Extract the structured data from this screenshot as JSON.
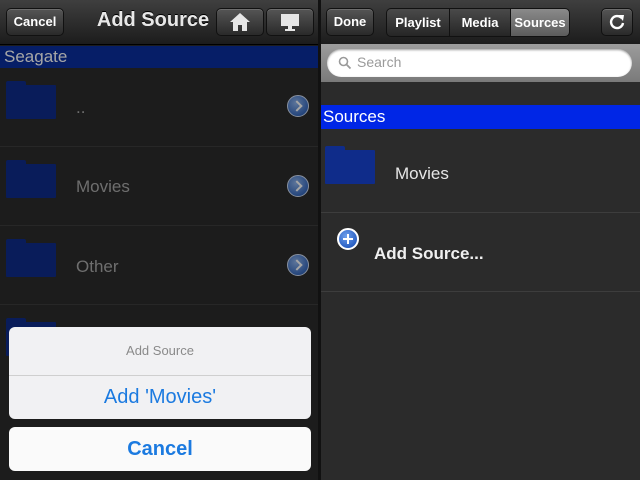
{
  "left_panel": {
    "navbar": {
      "cancel_label": "Cancel",
      "title": "Add Source",
      "home_icon": "home-icon",
      "display_icon": "monitor-icon"
    },
    "section_header": "Seagate",
    "rows": [
      {
        "label": "..",
        "icon": "folder-icon"
      },
      {
        "label": "Movies",
        "icon": "folder-icon"
      },
      {
        "label": "Other",
        "icon": "folder-icon"
      }
    ],
    "action_sheet": {
      "title": "Add Source",
      "action_label": "Add 'Movies'",
      "cancel_label": "Cancel"
    }
  },
  "right_panel": {
    "navbar": {
      "done_label": "Done",
      "segments": [
        "Playlist",
        "Media",
        "Sources"
      ],
      "selected_segment": "Sources",
      "refresh_icon": "refresh-icon"
    },
    "search": {
      "placeholder": "Search"
    },
    "section_header": "Sources",
    "items": [
      {
        "label": "Movies",
        "icon": "folder-icon"
      }
    ],
    "add_source_label": "Add Source..."
  },
  "colors": {
    "section_header_left": "#0a2f9e",
    "section_header_right": "#0026e6",
    "folder_blue": "#0f2c8a",
    "link_blue": "#1b7ae0",
    "background": "#2b2b2b"
  }
}
